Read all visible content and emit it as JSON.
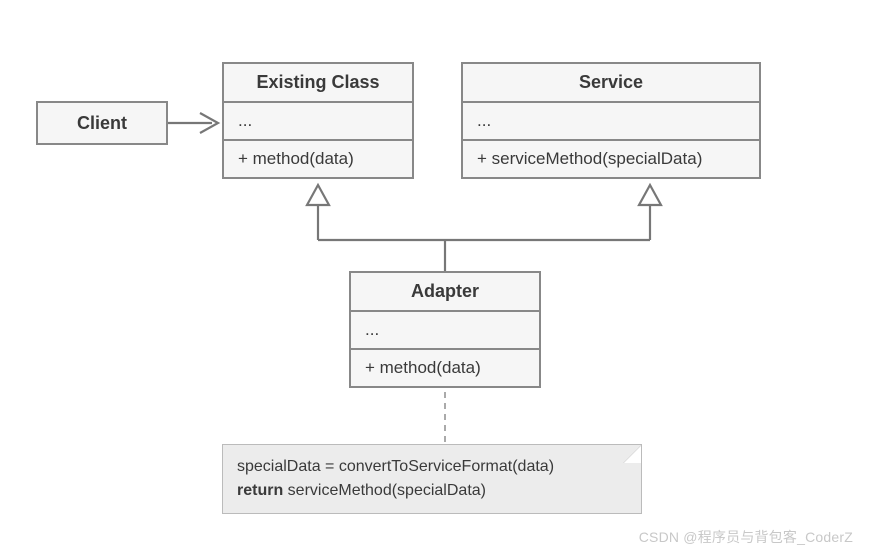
{
  "diagram": {
    "client": {
      "title": "Client"
    },
    "existingClass": {
      "title": "Existing Class",
      "attrs": "...",
      "method": "+ method(data)"
    },
    "service": {
      "title": "Service",
      "attrs": "...",
      "method": "+ serviceMethod(specialData)"
    },
    "adapter": {
      "title": "Adapter",
      "attrs": "...",
      "method": "+ method(data)"
    },
    "note": {
      "line1": "specialData = convertToServiceFormat(data)",
      "returnKw": "return",
      "line2rest": " serviceMethod(specialData)"
    }
  },
  "watermark": "CSDN @程序员与背包客_CoderZ"
}
